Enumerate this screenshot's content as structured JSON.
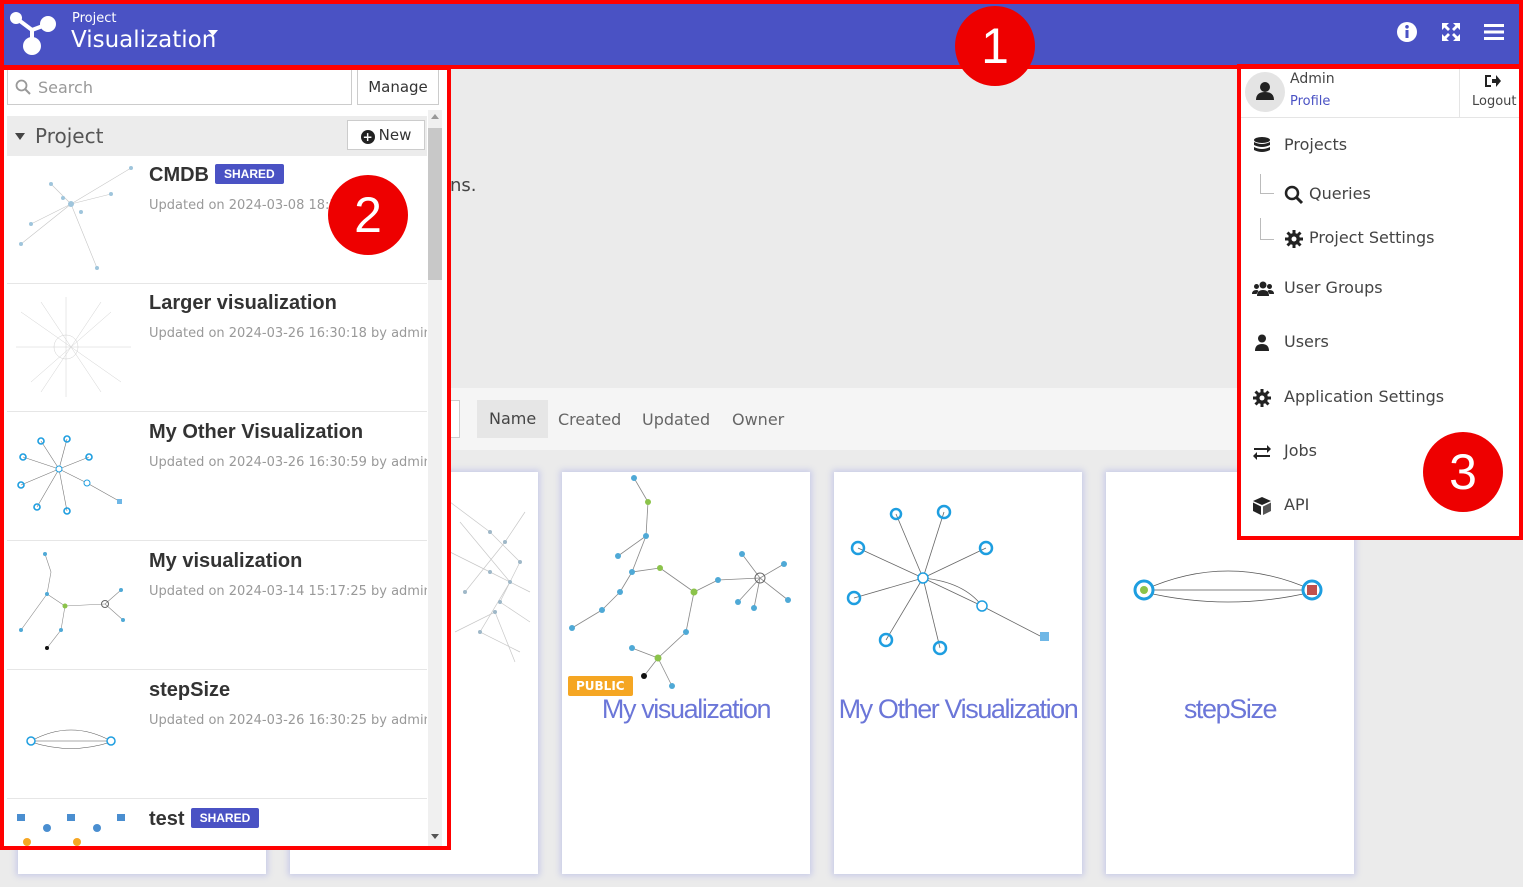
{
  "topbar": {
    "project_small": "Project",
    "project_title": "Visualization",
    "icons": [
      "info-icon",
      "expand-icon",
      "hamburger-menu-icon"
    ]
  },
  "main": {
    "partial_text": "ns.",
    "sort_tabs": [
      "Name",
      "Created",
      "Updated",
      "Owner"
    ],
    "active_sort": "Name",
    "cards": [
      {
        "title": "zation",
        "badge": ""
      },
      {
        "title": "My visualization",
        "badge": "PUBLIC"
      },
      {
        "title": "My Other Visualization",
        "badge": ""
      },
      {
        "title": "stepSize",
        "badge": ""
      }
    ]
  },
  "left_panel": {
    "search_placeholder": "Search",
    "manage_label": "Manage",
    "project_header": "Project",
    "new_label": "New",
    "items": [
      {
        "title": "CMDB",
        "badge": "SHARED",
        "meta": "Updated on 2024-03-08 18:3"
      },
      {
        "title": "Larger visualization",
        "badge": "",
        "meta": "Updated on 2024-03-26 16:30:18 by admin"
      },
      {
        "title": "My Other Visualization",
        "badge": "",
        "meta": "Updated on 2024-03-26 16:30:59 by admin"
      },
      {
        "title": "My visualization",
        "badge": "",
        "meta": "Updated on 2024-03-14 15:17:25 by admin"
      },
      {
        "title": "stepSize",
        "badge": "",
        "meta": "Updated on 2024-03-26 16:30:25 by admin"
      },
      {
        "title": "test",
        "badge": "SHARED",
        "meta": ""
      }
    ]
  },
  "dropdown": {
    "user_name": "Admin",
    "profile_label": "Profile",
    "logout_label": "Logout",
    "items": [
      {
        "label": "Projects",
        "icon": "database-icon"
      },
      {
        "label": "Queries",
        "icon": "search-icon"
      },
      {
        "label": "Project Settings",
        "icon": "gear-icon"
      },
      {
        "label": "User Groups",
        "icon": "users-icon"
      },
      {
        "label": "Users",
        "icon": "user-icon"
      },
      {
        "label": "Application Settings",
        "icon": "gear-icon"
      },
      {
        "label": "Jobs",
        "icon": "exchange-icon"
      },
      {
        "label": "API",
        "icon": "cube-icon"
      }
    ]
  },
  "annotations": {
    "marker_1": "1",
    "marker_2": "2",
    "marker_3": "3",
    "color": "#ff0000"
  },
  "colors": {
    "topbar": "#4a52c4",
    "accent": "#4a52c4",
    "card_title": "#6b76d8",
    "public_badge": "#f5a623"
  }
}
